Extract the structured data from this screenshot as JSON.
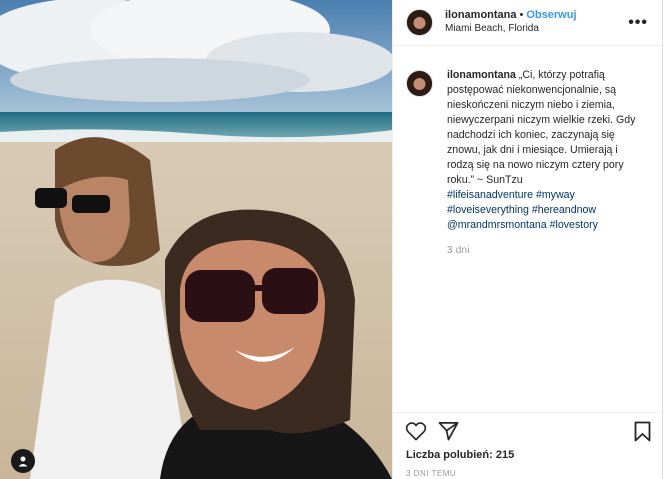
{
  "post": {
    "username": "ilonamontana",
    "follow_label": "Obserwuj",
    "location": "Miami Beach, Florida"
  },
  "caption": {
    "username": "ilonamontana",
    "text": "„Ci, którzy potrafią postępować niekonwencjonalnie, są nieskończeni niczym niebo i ziemia, niewyczerpani niczym wielkie rzeki. Gdy nadchodzi ich koniec, zaczynają się znowu, jak dni i miesiące. Umierają i rodzą się na nowo niczym cztery pory roku.” ~ SunTzu",
    "tags": [
      "#lifeisanadventure",
      "#myway",
      "#loveiseverything",
      "#hereandnow",
      "@mrandmrsmontana",
      "#lovestory"
    ],
    "time_ago": "3 dni"
  },
  "stats": {
    "likes_label": "Liczba polubień:",
    "likes_count": "215",
    "date": "3 DNI TEMU"
  },
  "icons": {
    "more": "more-options-icon",
    "like": "heart-icon",
    "share": "share-icon",
    "save": "bookmark-icon",
    "tag": "user-tag-icon"
  },
  "colors": {
    "link": "#3897f0",
    "hashtag": "#003569",
    "muted": "#999999"
  }
}
